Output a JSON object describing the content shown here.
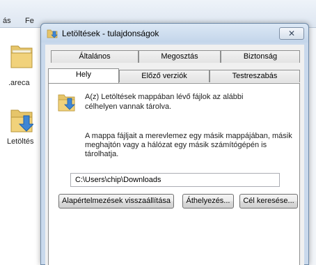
{
  "background": {
    "menu_items": [
      "ás",
      "Fe"
    ],
    "folders": [
      {
        "label": ".areca"
      },
      {
        "label": "Letöltés"
      }
    ]
  },
  "dialog": {
    "title": "Letöltések - tulajdonságok",
    "close_label": "✕",
    "tabs_row1": [
      "Általános",
      "Megosztás",
      "Biztonság"
    ],
    "tabs_row2": [
      "Hely",
      "Előző verziók",
      "Testreszabás"
    ],
    "active_tab": "Hely",
    "description": [
      "A(z) Letöltések mappában lévő fájlok az alábbi",
      "célhelyen vannak tárolva."
    ],
    "move_info": [
      "A mappa fájljait a merevlemez egy másik mappájában, másik",
      "meghajtón vagy a hálózat egy másik számítógépén is",
      "tárolhatja."
    ],
    "path_value": "C:\\Users\\chip\\Downloads",
    "buttons": {
      "restore_default": "Alapértelmezések visszaállítása",
      "move": "Áthelyezés...",
      "find_target": "Cél keresése..."
    }
  }
}
